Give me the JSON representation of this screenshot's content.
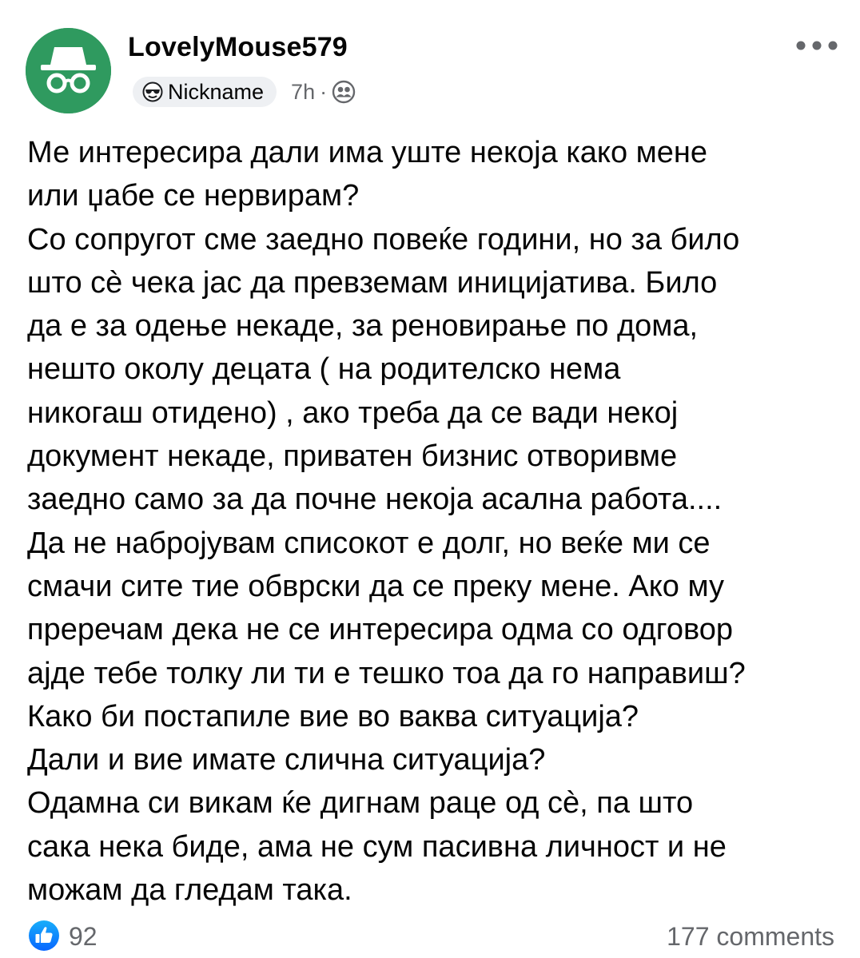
{
  "post": {
    "author": "LovelyMouse579",
    "avatar_icon": "incognito-icon",
    "badge": {
      "icon": "sunglasses-emoji-icon",
      "label": "Nickname"
    },
    "time": "7h",
    "separator": "·",
    "privacy_icon": "friends-icon",
    "more_icon": "more-horizontal-icon",
    "body": "Ме интересира дали има уште некоја како мене\nили џабе се нервирам?\nСо сопругот сме заедно повеќе години, но за било\nшто сè чека јас да превземам иницијатива. Било\nда е за одење некаде, за реновирање по дома,\nнешто околу децата ( на родителско нема\nникогаш отидено) , ако треба да се вади некој\nдокумент некаде, приватен бизнис отворивме\nзаедно само за да почне некоја асална работа....\nДа не набројувам списокот е долг, но веќе ми се\nсмачи сите тие обврски да се преку мене. Ако му\nпреречам дека не се интересира одма со одговор\nајде тебе толку ли ти е тешко тоа да го направиш?\nКако би постапиле вие во ваква ситуација?\nДали и вие имате слична ситуација?\nОдамна си викам ќе дигнам раце од сè, па што\nсака нека биде, ама не сум пасивна личност и не\nможам да гледам така."
  },
  "footer": {
    "reaction_icon": "like-icon",
    "reaction_count": "92",
    "comments": "177 comments"
  },
  "colors": {
    "avatar_bg": "#2f9a5f",
    "badge_bg": "#eef0f3",
    "secondary_text": "#65676b",
    "like_blue": "#1877f2",
    "text": "#050505"
  }
}
